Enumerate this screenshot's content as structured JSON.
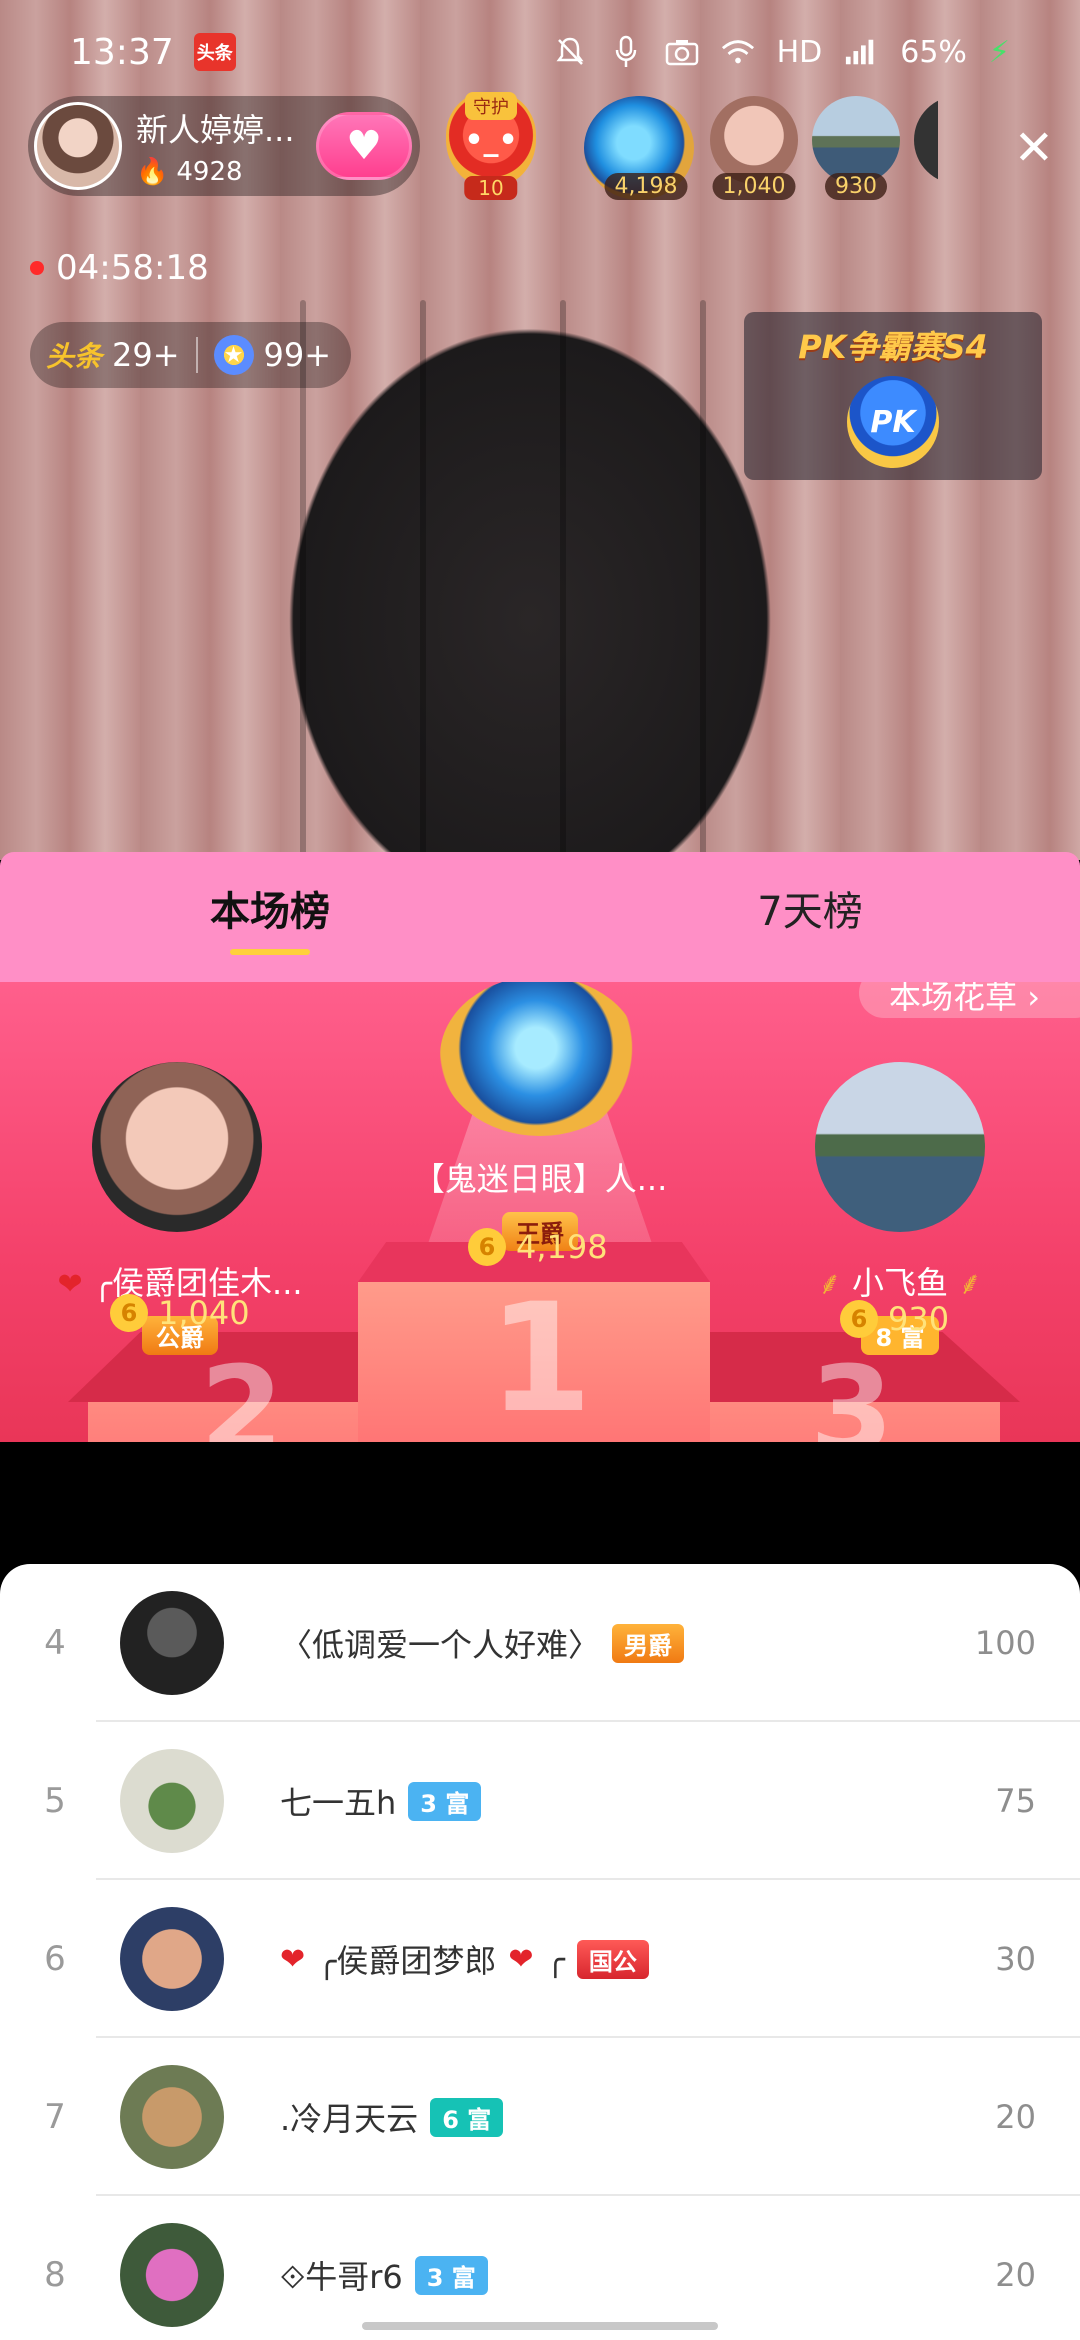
{
  "status_bar": {
    "time": "13:37",
    "app_badge": "头条",
    "network": "HD",
    "signal": "4G",
    "battery": "65%"
  },
  "streamer": {
    "name": "新人婷婷...",
    "heat": "4928"
  },
  "guard": {
    "tag": "守护",
    "level": "10"
  },
  "top_viewers": [
    {
      "score": "4,198"
    },
    {
      "score": "1,040"
    },
    {
      "score": "930"
    }
  ],
  "live_timer": "04:58:18",
  "stats": {
    "logo_text": "头条",
    "headline_count": "29+",
    "star_count": "99+"
  },
  "pk_panel": {
    "title": "PK争霸赛S4",
    "button": "PK"
  },
  "tabs": [
    {
      "label": "本场榜",
      "active": true
    },
    {
      "label": "7天榜",
      "active": false
    }
  ],
  "podium": {
    "rule_label": "本场花草 ›",
    "first": {
      "name": "【鬼迷日眼】人...",
      "badge": "王爵",
      "score": "4,198",
      "rank": "1"
    },
    "second": {
      "name": "╭侯爵团佳木...",
      "badge": "公爵",
      "score": "1,040",
      "rank": "2"
    },
    "third": {
      "name": "小飞鱼",
      "badge": "8 富",
      "score": "930",
      "rank": "3"
    }
  },
  "list": [
    {
      "rank": "4",
      "name": "〈低调爱一个人好难〉",
      "badge": "男爵",
      "value": "100"
    },
    {
      "rank": "5",
      "name": "七一五h",
      "badge": "3 富",
      "value": "75"
    },
    {
      "rank": "6",
      "name": "╭侯爵团梦郎",
      "name_suffix": "╭",
      "badge": "国公",
      "value": "30"
    },
    {
      "rank": "7",
      "name": ".冷月天云",
      "badge": "6 富",
      "value": "20"
    },
    {
      "rank": "8",
      "name": "⟐牛哥r6",
      "badge": "3 富",
      "value": "20"
    }
  ],
  "colors": {
    "tab_bar": "#ff8fc6",
    "podium_bg": "#f4416a",
    "tab_underline": "#ffd03a",
    "score_text": "#ffe27a"
  }
}
